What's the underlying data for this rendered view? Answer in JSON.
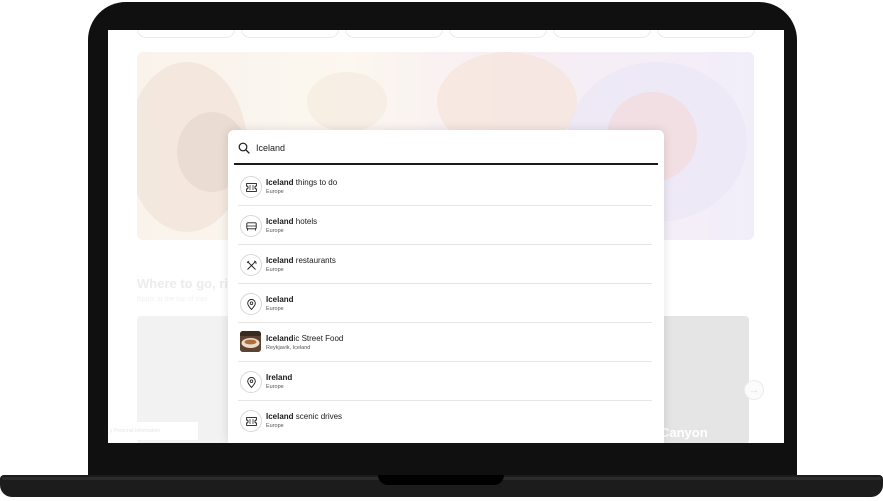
{
  "search": {
    "query": "Iceland"
  },
  "results": [
    {
      "bold": "Iceland",
      "rest": " things to do",
      "sub": "Europe",
      "icon": "ticket-icon"
    },
    {
      "bold": "Iceland",
      "rest": " hotels",
      "sub": "Europe",
      "icon": "bed-icon"
    },
    {
      "bold": "Iceland",
      "rest": " restaurants",
      "sub": "Europe",
      "icon": "utensils-icon"
    },
    {
      "bold": "Iceland",
      "rest": "",
      "sub": "Europe",
      "icon": "location-pin-icon"
    },
    {
      "bold": "Iceland",
      "rest": "ic Street Food",
      "sub": "Reykjavik, Iceland",
      "icon": "food-thumbnail"
    },
    {
      "bold": "Ireland",
      "rest": "",
      "sub": "Europe",
      "icon": "location-pin-icon"
    },
    {
      "bold": "Iceland",
      "rest": " scenic drives",
      "sub": "Europe",
      "icon": "ticket-icon"
    }
  ],
  "background": {
    "section_title": "Where to go, ri",
    "section_sub": "Spots at the top of trav",
    "card_title": "Canyon",
    "privacy_link": "y Personal Information"
  },
  "colors": {
    "frame": "#101010",
    "underline": "#1a1a1a",
    "divider": "#e6e6e6"
  }
}
